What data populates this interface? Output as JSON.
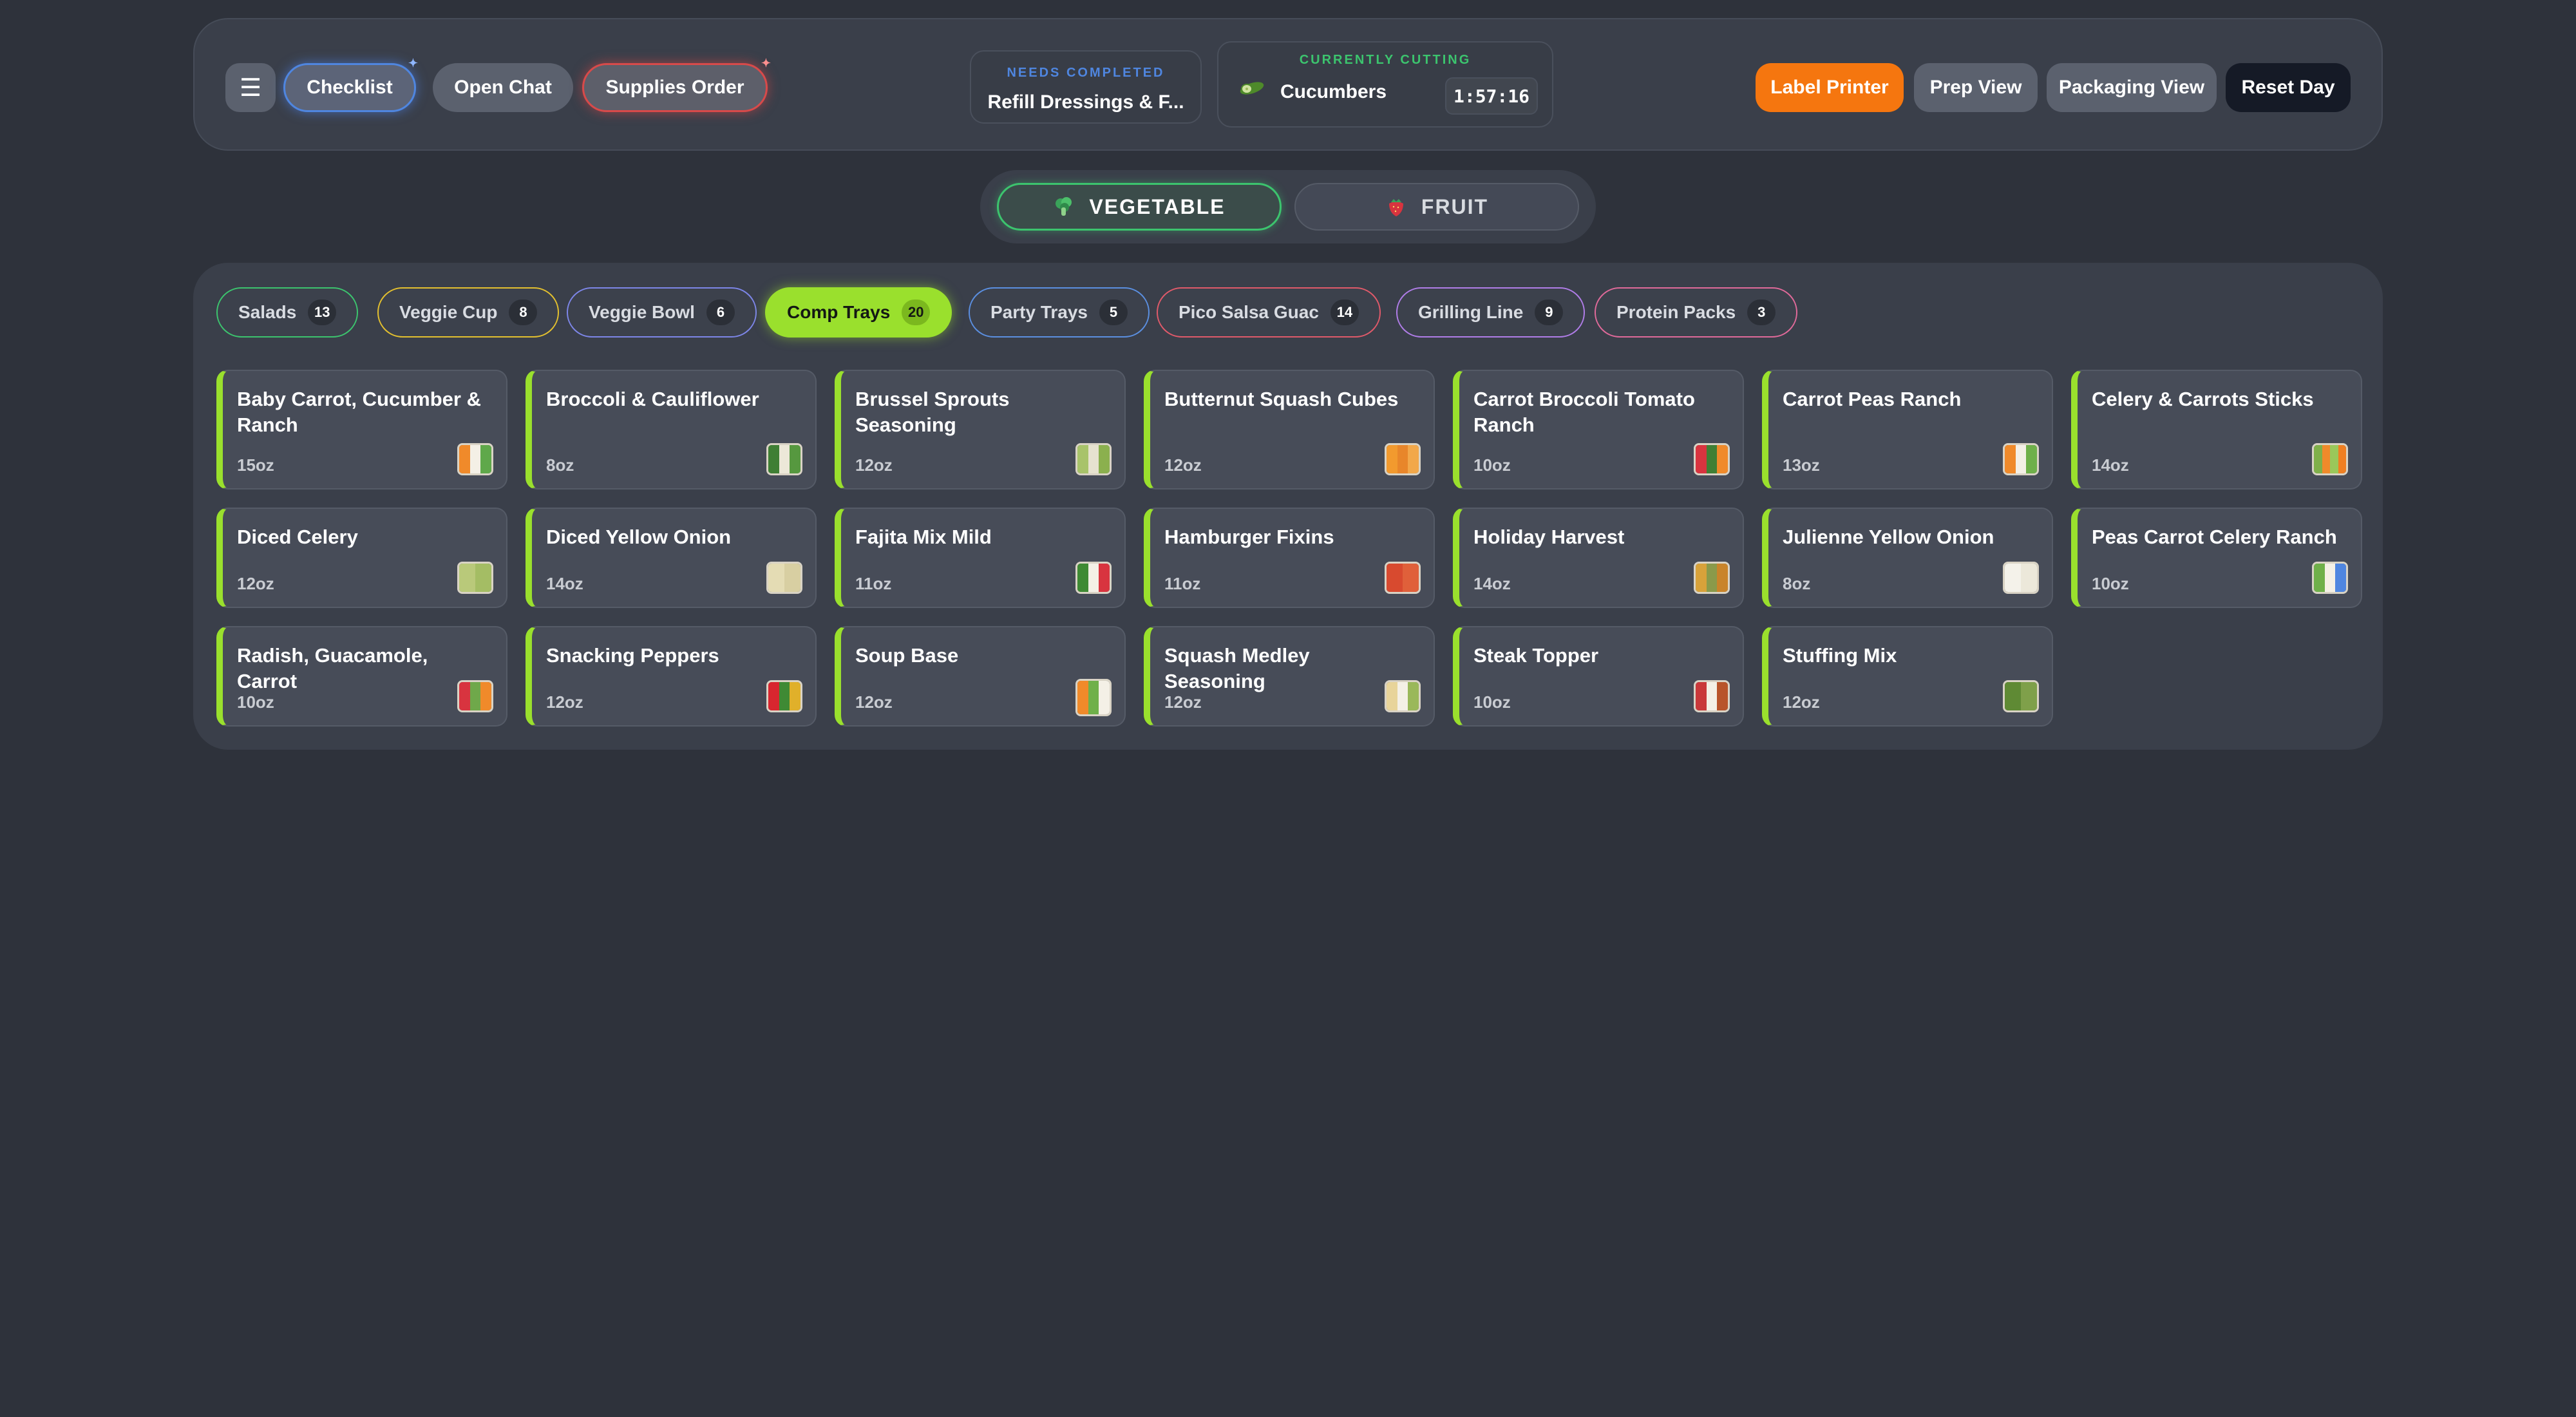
{
  "header": {
    "menu_icon": "menu-icon",
    "checklist_label": "Checklist",
    "open_chat_label": "Open Chat",
    "supplies_order_label": "Supplies Order",
    "needs_completed": {
      "caption": "NEEDS COMPLETED",
      "value": "Refill Dressings & F..."
    },
    "currently_cutting": {
      "caption": "CURRENTLY CUTTING",
      "item": "Cucumbers",
      "timer": "1:57:16",
      "icon": "cucumber-icon"
    },
    "label_printer_label": "Label Printer",
    "prep_view_label": "Prep View",
    "packaging_view_label": "Packaging View",
    "reset_day_label": "Reset Day"
  },
  "type_toggle": {
    "vegetable": {
      "label": "VEGETABLE",
      "icon": "broccoli-icon",
      "active": true
    },
    "fruit": {
      "label": "FRUIT",
      "icon": "strawberry-icon",
      "active": false
    }
  },
  "categories": [
    {
      "label": "Salads",
      "count": "13",
      "color": "#3cc46e"
    },
    {
      "label": "Veggie Cup",
      "count": "8",
      "color": "#e3c02f"
    },
    {
      "label": "Veggie Bowl",
      "count": "6",
      "color": "#7d86e8"
    },
    {
      "label": "Comp Trays",
      "count": "20",
      "color": "#9ae02d",
      "active": true
    },
    {
      "label": "Party Trays",
      "count": "5",
      "color": "#5b8fe0"
    },
    {
      "label": "Pico Salsa Guac",
      "count": "14",
      "color": "#e05a6a"
    },
    {
      "label": "Grilling Line",
      "count": "9",
      "color": "#b07de8"
    },
    {
      "label": "Protein Packs",
      "count": "3",
      "color": "#e06a9a"
    }
  ],
  "products": [
    {
      "name": "Baby Carrot, Cucumber & Ranch",
      "size": "15oz"
    },
    {
      "name": "Broccoli & Cauliflower",
      "size": "8oz"
    },
    {
      "name": "Brussel Sprouts Seasoning",
      "size": "12oz"
    },
    {
      "name": "Butternut Squash Cubes",
      "size": "12oz"
    },
    {
      "name": "Carrot Broccoli Tomato Ranch",
      "size": "10oz"
    },
    {
      "name": "Carrot Peas Ranch",
      "size": "13oz"
    },
    {
      "name": "Celery & Carrots Sticks",
      "size": "14oz"
    },
    {
      "name": "Diced Celery",
      "size": "12oz"
    },
    {
      "name": "Diced Yellow Onion",
      "size": "14oz"
    },
    {
      "name": "Fajita Mix Mild",
      "size": "11oz"
    },
    {
      "name": "Hamburger Fixins",
      "size": "11oz"
    },
    {
      "name": "Holiday Harvest",
      "size": "14oz"
    },
    {
      "name": "Julienne Yellow Onion",
      "size": "8oz"
    },
    {
      "name": "Peas Carrot Celery Ranch",
      "size": "10oz"
    },
    {
      "name": "Radish, Guacamole, Carrot",
      "size": "10oz"
    },
    {
      "name": "Snacking Peppers",
      "size": "12oz"
    },
    {
      "name": "Soup Base",
      "size": "12oz"
    },
    {
      "name": "Squash Medley Seasoning",
      "size": "12oz"
    },
    {
      "name": "Steak Topper",
      "size": "10oz"
    },
    {
      "name": "Stuffing Mix",
      "size": "12oz"
    }
  ],
  "colors": {
    "accent_green": "#9ae02d",
    "label_printer": "#f5760f",
    "reset_day": "#151a26",
    "needs_blue": "#4f86e0",
    "cutting_green": "#3cc46e"
  }
}
